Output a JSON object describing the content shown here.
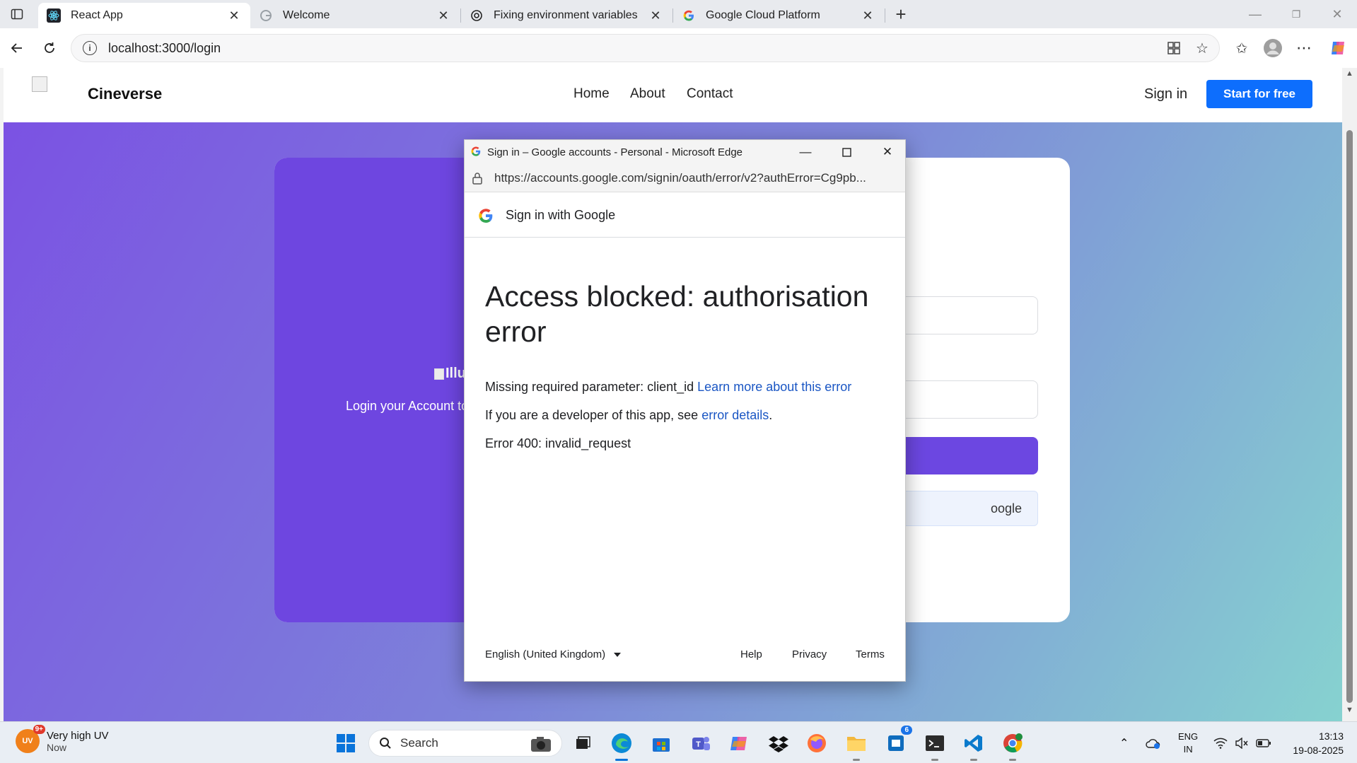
{
  "browser": {
    "tabs": [
      {
        "title": "React App",
        "icon": "react-icon"
      },
      {
        "title": "Welcome",
        "icon": "google-icon"
      },
      {
        "title": "Fixing environment variables",
        "icon": "openai-icon"
      },
      {
        "title": "Google Cloud Platform",
        "icon": "google-icon"
      }
    ],
    "address": "localhost:3000/login"
  },
  "site": {
    "brand": "Cineverse",
    "nav": [
      "Home",
      "About",
      "Contact"
    ],
    "sign_in": "Sign in",
    "start_button": "Start for free",
    "illustration_alt": "Illu",
    "login_text": "Login your Account to",
    "google_button_partial": "oogle"
  },
  "popup": {
    "window_title": "Sign in – Google accounts - Personal - Microsoft Edge",
    "url": "https://accounts.google.com/signin/oauth/error/v2?authError=Cg9pb...",
    "header": "Sign in with Google",
    "heading": "Access blocked: authorisation error",
    "line1_text": "Missing required parameter: client_id",
    "line1_link": "Learn more about this error",
    "line2_text": "If you are a developer of this app, see",
    "line2_link": "error details",
    "line2_end": ".",
    "line3": "Error 400: invalid_request",
    "language": "English (United Kingdom)",
    "footer_links": [
      "Help",
      "Privacy",
      "Terms"
    ]
  },
  "taskbar": {
    "weather_badge": "9+",
    "weather_icon": "UV",
    "weather_title": "Very high UV",
    "weather_sub": "Now",
    "search_label": "Search",
    "store_badge": "6",
    "tray_lang1": "ENG",
    "tray_lang2": "IN",
    "time": "13:13",
    "date": "19-08-2025"
  },
  "colors": {
    "accent": "#0d6efd",
    "purple": "#6e46e0",
    "link": "#1a56c4"
  }
}
